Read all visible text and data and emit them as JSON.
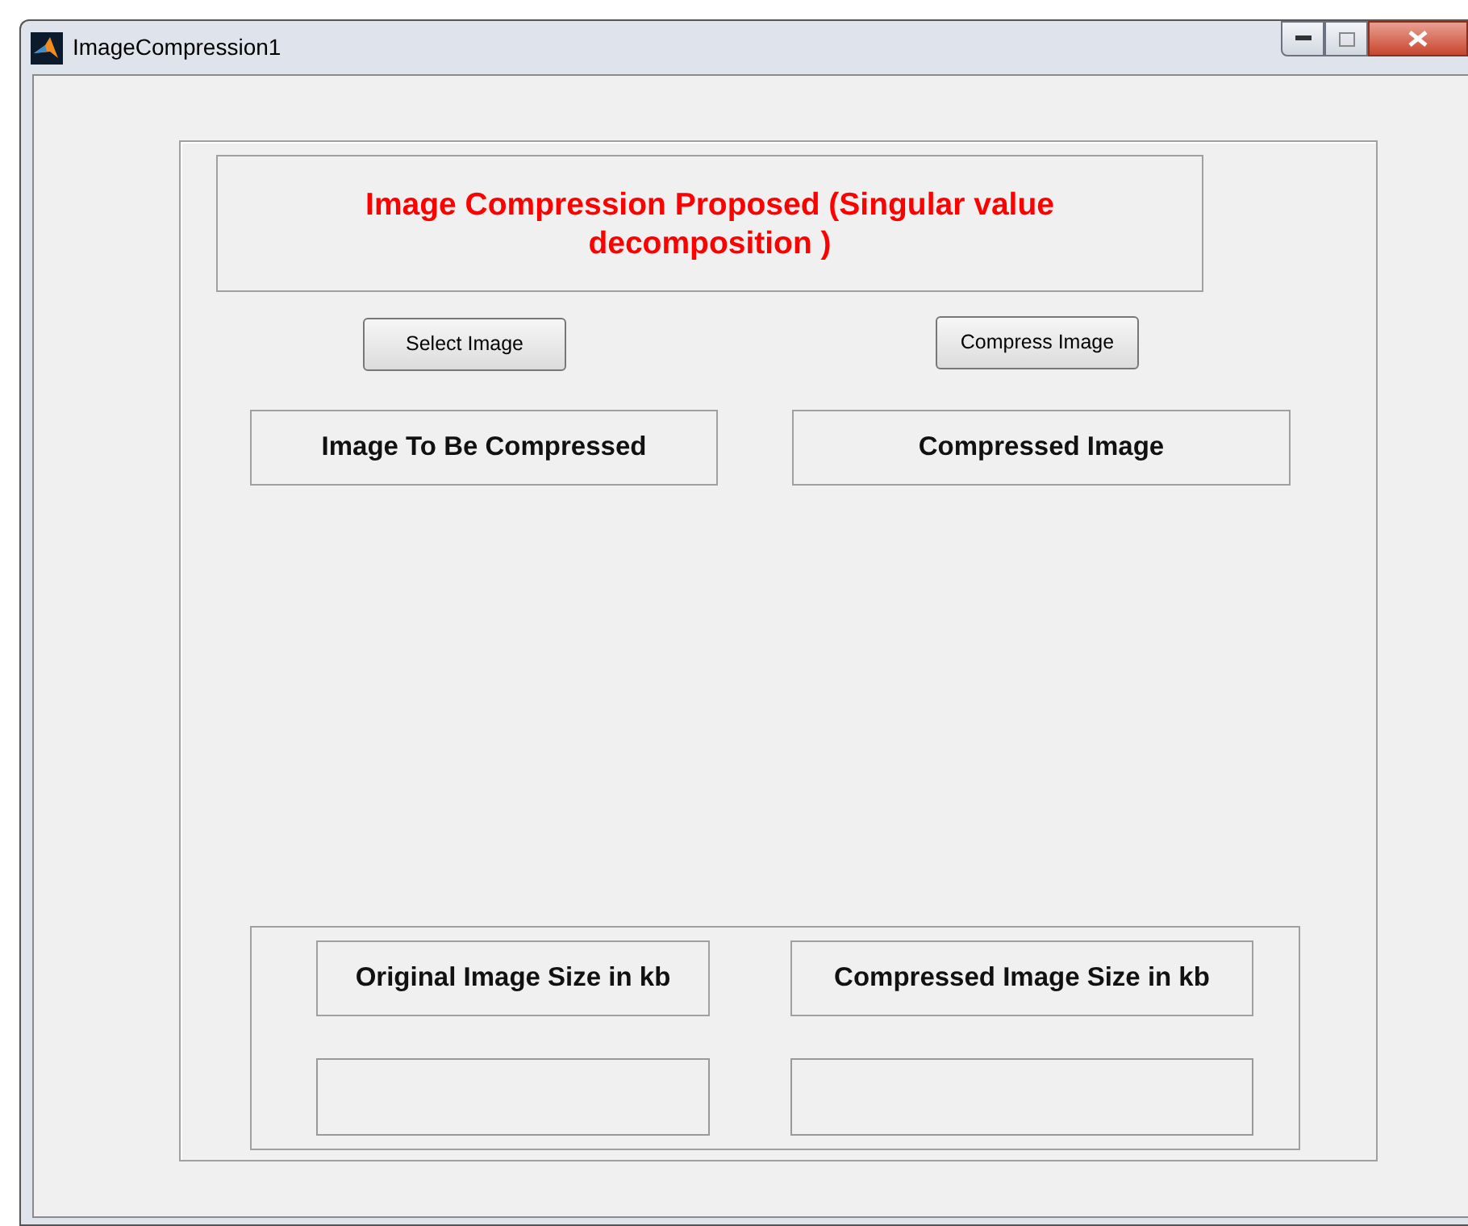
{
  "window": {
    "title": "ImageCompression1"
  },
  "heading": "Image Compression Proposed (Singular value decomposition )",
  "buttons": [
    "Select Image",
    "Compress Image"
  ],
  "image_labels": [
    "Image To Be Compressed",
    "Compressed Image"
  ],
  "size_labels": [
    "Original Image Size in kb",
    "Compressed Image Size in kb"
  ]
}
